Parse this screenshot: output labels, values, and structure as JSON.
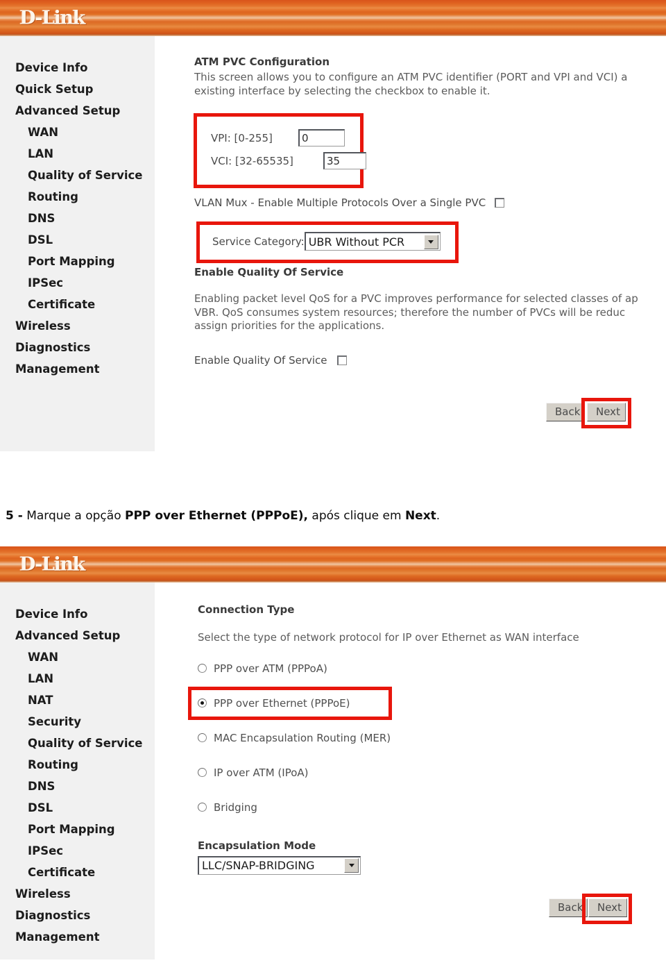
{
  "brand": {
    "logo_text": "D-Link"
  },
  "panel_one": {
    "sidebar": {
      "items": [
        {
          "label": "Device Info",
          "level": 1
        },
        {
          "label": "Quick Setup",
          "level": 1
        },
        {
          "label": "Advanced Setup",
          "level": 1
        },
        {
          "label": "WAN",
          "level": 2
        },
        {
          "label": "LAN",
          "level": 2
        },
        {
          "label": "Quality of Service",
          "level": 2
        },
        {
          "label": "Routing",
          "level": 2
        },
        {
          "label": "DNS",
          "level": 2
        },
        {
          "label": "DSL",
          "level": 2
        },
        {
          "label": "Port Mapping",
          "level": 2
        },
        {
          "label": "IPSec",
          "level": 2
        },
        {
          "label": "Certificate",
          "level": 2
        },
        {
          "label": "Wireless",
          "level": 1
        },
        {
          "label": "Diagnostics",
          "level": 1
        },
        {
          "label": "Management",
          "level": 1
        }
      ]
    },
    "content": {
      "title": "ATM PVC Configuration",
      "description_line1": "This screen allows you to configure an ATM PVC identifier (PORT and VPI and VCI) a",
      "description_line2": "existing interface by selecting the checkbox to enable it.",
      "vpi_label": "VPI: [0-255]",
      "vpi_value": "0",
      "vci_label": "VCI: [32-65535]",
      "vci_value": "35",
      "vlan_mux_label": "VLAN Mux - Enable Multiple Protocols Over a Single PVC",
      "service_category_label": "Service Category:",
      "service_category_value": "UBR Without PCR",
      "qos_heading": "Enable Quality Of Service",
      "qos_para_line1": "Enabling packet level QoS for a PVC improves performance for selected classes of ap",
      "qos_para_line2": "VBR.  QoS consumes system resources; therefore the number of PVCs will be reduc",
      "qos_para_line3": "assign priorities for the applications.",
      "qos_checkbox_label": "Enable Quality Of Service",
      "back_label": "Back",
      "next_label": "Next"
    }
  },
  "caption": {
    "number": "5 -",
    "text_1": " Marque a opção ",
    "bold_1": "PPP over Ethernet (PPPoE),",
    "text_2": " após clique em ",
    "bold_2": "Next",
    "text_3": "."
  },
  "panel_two": {
    "sidebar": {
      "items": [
        {
          "label": "Device Info",
          "level": 1
        },
        {
          "label": "Advanced Setup",
          "level": 1
        },
        {
          "label": "WAN",
          "level": 2
        },
        {
          "label": "LAN",
          "level": 2
        },
        {
          "label": "NAT",
          "level": 2
        },
        {
          "label": "Security",
          "level": 2
        },
        {
          "label": "Quality of Service",
          "level": 2
        },
        {
          "label": "Routing",
          "level": 2
        },
        {
          "label": "DNS",
          "level": 2
        },
        {
          "label": "DSL",
          "level": 2
        },
        {
          "label": "Port Mapping",
          "level": 2
        },
        {
          "label": "IPSec",
          "level": 2
        },
        {
          "label": "Certificate",
          "level": 2
        },
        {
          "label": "Wireless",
          "level": 1
        },
        {
          "label": "Diagnostics",
          "level": 1
        },
        {
          "label": "Management",
          "level": 1
        }
      ]
    },
    "content": {
      "title": "Connection Type",
      "description": "Select the type of network protocol for IP over Ethernet as WAN interface",
      "options": [
        {
          "label": "PPP over ATM (PPPoA)",
          "selected": false
        },
        {
          "label": "PPP over Ethernet (PPPoE)",
          "selected": true
        },
        {
          "label": "MAC Encapsulation Routing (MER)",
          "selected": false
        },
        {
          "label": "IP over ATM (IPoA)",
          "selected": false
        },
        {
          "label": "Bridging",
          "selected": false
        }
      ],
      "encapsulation_label": "Encapsulation Mode",
      "encapsulation_value": "LLC/SNAP-BRIDGING",
      "back_label": "Back",
      "next_label": "Next"
    }
  },
  "colors": {
    "brand_orange": "#de6520",
    "highlight_red": "#e8160c",
    "sidebar_bg": "#f1f1f1"
  }
}
